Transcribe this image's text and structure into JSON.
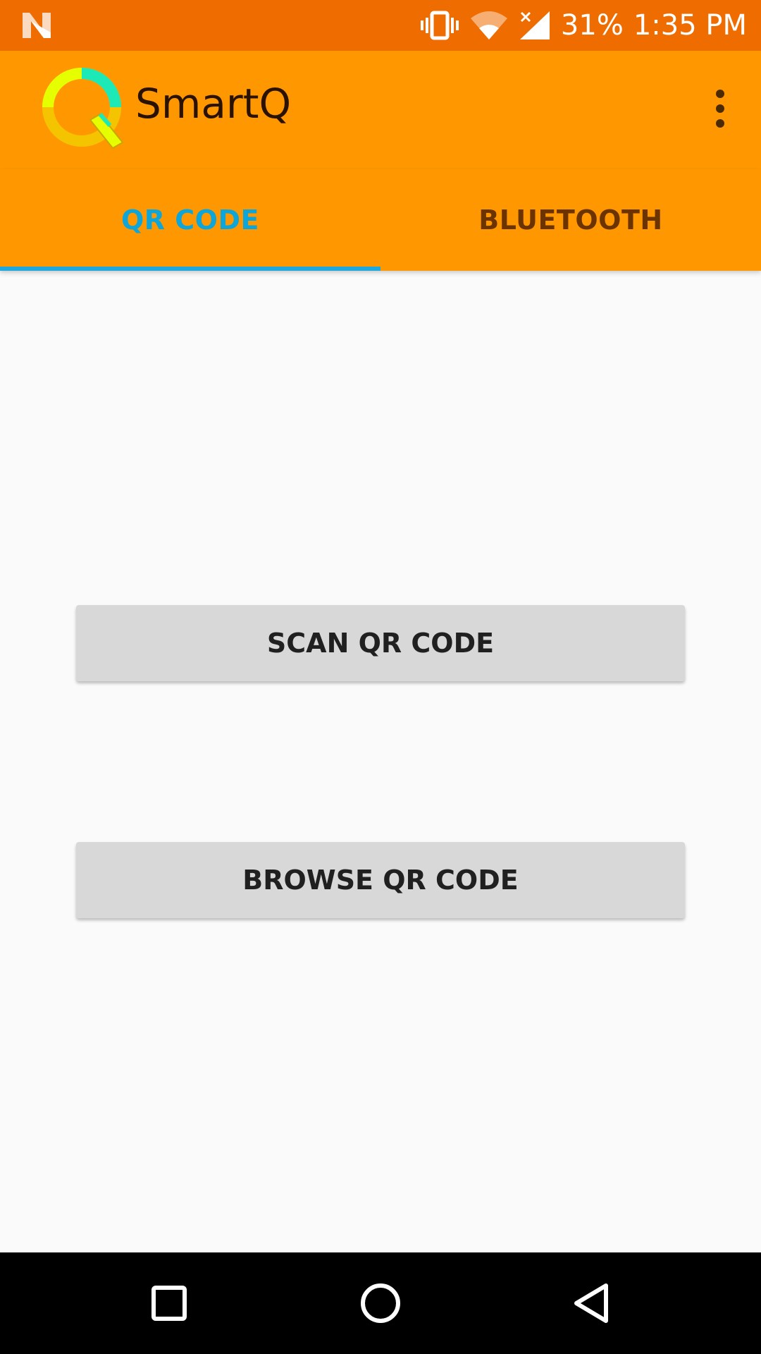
{
  "status_bar": {
    "battery_text": "31%",
    "time": "1:35 PM",
    "icons": [
      "notification-n-icon",
      "vibrate-icon",
      "wifi-icon",
      "signal-icon"
    ]
  },
  "toolbar": {
    "title": "SmartQ",
    "logo": "smartq-logo",
    "menu_icon": "more-vert-icon"
  },
  "tabs": [
    {
      "label": "QR CODE",
      "selected": true
    },
    {
      "label": "BLUETOOTH",
      "selected": false
    }
  ],
  "main": {
    "scan_button_label": "SCAN QR CODE",
    "browse_button_label": "BROWSE QR CODE"
  },
  "nav_bar": {
    "icons": [
      "recents-icon",
      "home-icon",
      "back-icon"
    ]
  },
  "colors": {
    "status_bar": "#ef6c00",
    "toolbar": "#ff9800",
    "tab_active": "#0ea5d8",
    "tab_inactive": "#6b3300",
    "tab_indicator": "#1ea8e0",
    "button_bg": "#d8d8d8",
    "background": "#fafafa"
  }
}
